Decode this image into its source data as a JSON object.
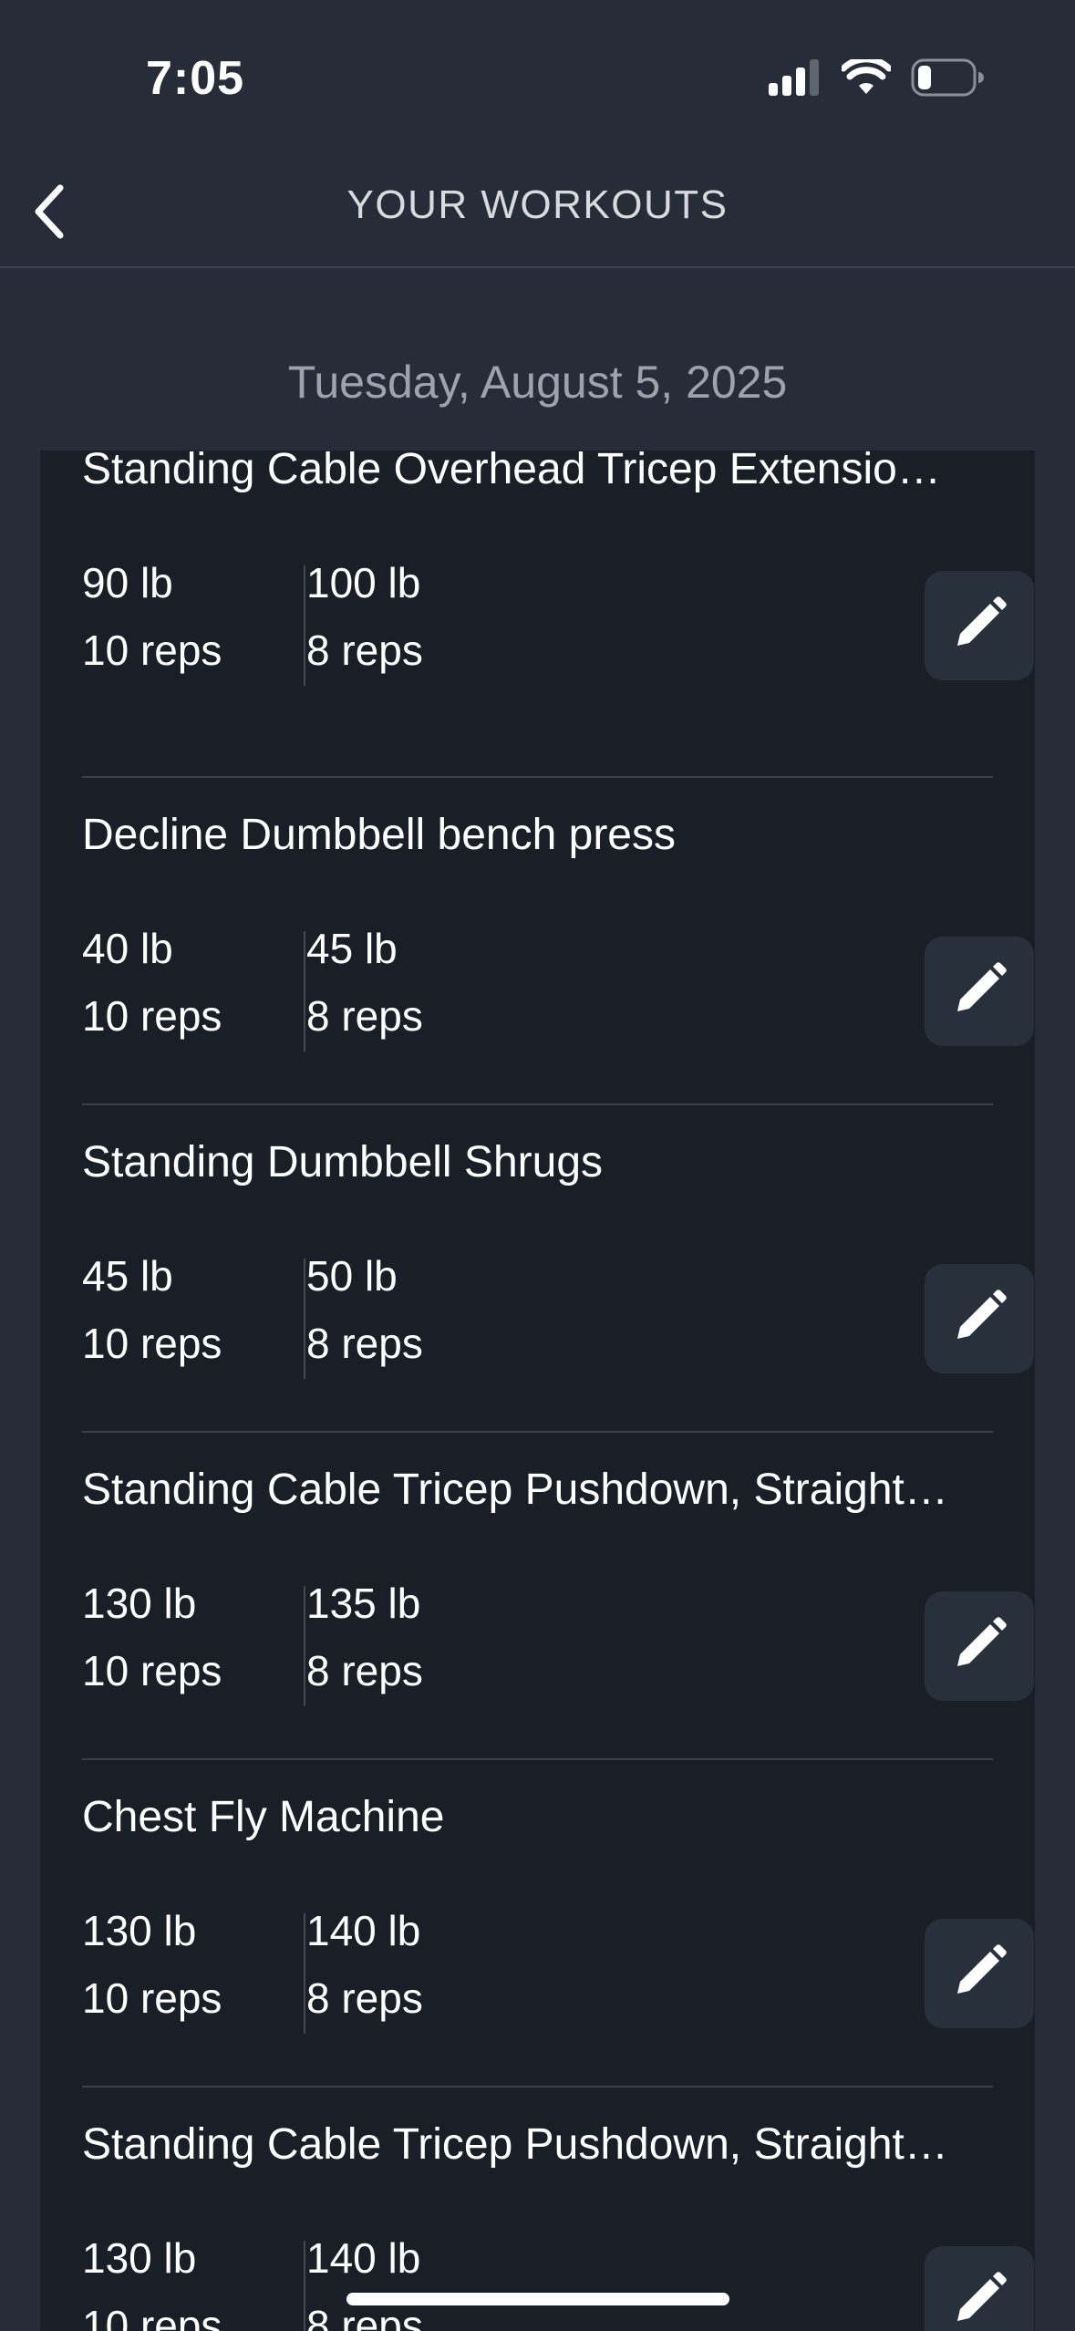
{
  "status_bar": {
    "time": "7:05",
    "icons": [
      "cellular-signal-icon",
      "wifi-icon",
      "battery-icon"
    ]
  },
  "nav": {
    "title": "YOUR WORKOUTS",
    "back_icon": "chevron-left-icon"
  },
  "date": "Tuesday, August 5, 2025",
  "workouts": [
    {
      "name": "Standing Cable Overhead Tricep Extensio…",
      "sets": [
        {
          "weight": "90 lb",
          "reps": "10 reps"
        },
        {
          "weight": "100 lb",
          "reps": "8 reps"
        }
      ]
    },
    {
      "name": "Decline Dumbbell bench press",
      "sets": [
        {
          "weight": "40 lb",
          "reps": "10 reps"
        },
        {
          "weight": "45 lb",
          "reps": "8 reps"
        }
      ]
    },
    {
      "name": "Standing Dumbbell Shrugs",
      "sets": [
        {
          "weight": "45 lb",
          "reps": "10 reps"
        },
        {
          "weight": "50 lb",
          "reps": "8 reps"
        }
      ]
    },
    {
      "name": "Standing Cable Tricep Pushdown, Straight…",
      "sets": [
        {
          "weight": "130 lb",
          "reps": "10 reps"
        },
        {
          "weight": "135 lb",
          "reps": "8 reps"
        }
      ]
    },
    {
      "name": "Chest Fly Machine",
      "sets": [
        {
          "weight": "130 lb",
          "reps": "10 reps"
        },
        {
          "weight": "140 lb",
          "reps": "8 reps"
        }
      ]
    },
    {
      "name": "Standing Cable Tricep Pushdown, Straight…",
      "sets": [
        {
          "weight": "130 lb",
          "reps": "10 reps"
        },
        {
          "weight": "140 lb",
          "reps": "8 reps"
        }
      ]
    }
  ],
  "edit_icon": "pencil-icon",
  "colors": {
    "background": "#262d38",
    "card": "#1a1f27",
    "edit_button": "#28303b",
    "muted_text": "#9ea3ab"
  }
}
